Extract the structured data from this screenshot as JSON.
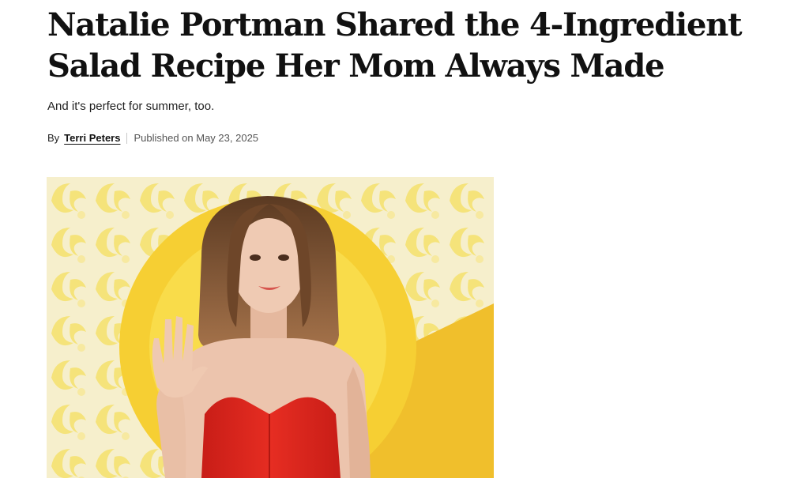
{
  "article": {
    "headline": "Natalie Portman Shared the 4-Ingredient Salad Recipe Her Mom Always Made",
    "dek": "And it's perfect for summer, too.",
    "byline": {
      "prefix": "By",
      "author": "Terri Peters",
      "published": "Published on May 23, 2025"
    }
  },
  "hero_image": {
    "subject": "woman-waving-red-strapless-dress",
    "colors": {
      "pattern_bg": "#f6efcc",
      "pattern_swirl": "#f5e37a",
      "sun": "#f6cf33",
      "sun_inner": "#f9dc4a",
      "wedge": "#f0bf2c",
      "dress": "#e0281f",
      "hair": "#7a4f30",
      "skin": "#ecc4ad"
    }
  }
}
